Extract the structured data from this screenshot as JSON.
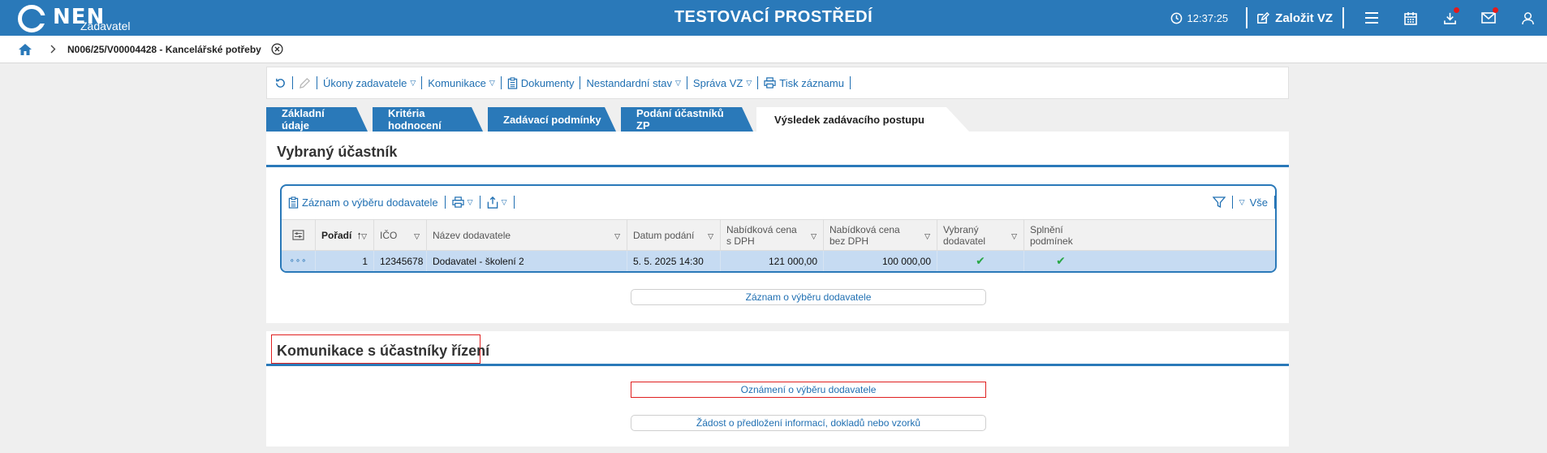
{
  "header": {
    "logo_text": "NEN",
    "logo_sub": "Zadavatel",
    "env_title": "TESTOVACÍ PROSTŘEDÍ",
    "time": "12:37:25",
    "create_label": "Založit VZ",
    "accent": "#2a79b9"
  },
  "breadcrumb": {
    "title": "N006/25/V00004428 - Kancelářské potřeby"
  },
  "toolbar": {
    "items": [
      "Úkony zadavatele",
      "Komunikace",
      "Dokumenty",
      "Nestandardní stav",
      "Správa VZ",
      "Tisk záznamu"
    ]
  },
  "tabs": [
    "Základní údaje",
    "Kritéria hodnocení",
    "Zadávací podmínky",
    "Podání účastníků ZP",
    "Výsledek zadávacího postupu"
  ],
  "section1": {
    "title": "Vybraný účastník",
    "grid_toolbar": {
      "record_label": "Záznam o výběru dodavatele",
      "all_label": "Vše"
    },
    "columns": [
      "Pořadí",
      "IČO",
      "Název dodavatele",
      "Datum podání",
      "Nabídková cena s DPH",
      "Nabídková cena bez DPH",
      "Vybraný dodavatel",
      "Splnění podmínek"
    ],
    "row": {
      "order": "1",
      "ico": "12345678",
      "name": "Dodavatel - školení 2",
      "date": "5. 5. 2025 14:30",
      "price_vat": "121 000,00",
      "price_novat": "100 000,00",
      "selected": "✔",
      "conditions": "✔"
    },
    "button": "Záznam o výběru dodavatele"
  },
  "section2": {
    "title": "Komunikace s účastníky řízení",
    "buttons": [
      "Oznámení o výběru dodavatele",
      "Žádost o předložení informací, dokladů nebo vzorků"
    ]
  }
}
